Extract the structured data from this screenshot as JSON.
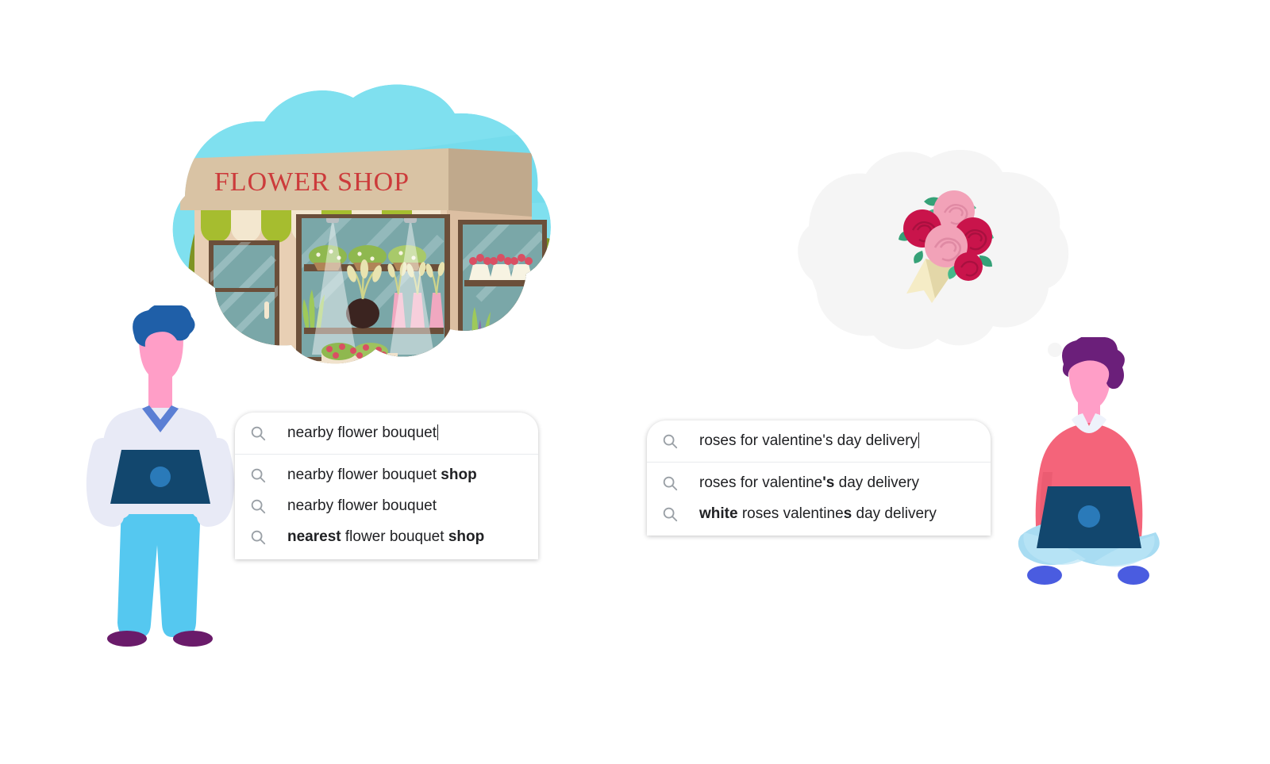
{
  "scene": {
    "background": "#ffffff",
    "left": {
      "name": "nearby-flower-shop-search",
      "thought_bubble": {
        "name": "flower-shop-thought-bubble",
        "fill": "#ffffff",
        "sky_color": "#7fe0ef",
        "sky_color_dark": "#63d6e8"
      },
      "shop": {
        "sign_text": "FLOWER SHOP",
        "sign_text_color": "#cc3b3b",
        "sign_fill": "#d9c3a4",
        "sign_fill_dark": "#c0a98c",
        "wall_color": "#e8cfb4",
        "awning_green": "#a6bd2f",
        "awning_cream": "#f3e7cf",
        "glass_color": "#7aa7a8",
        "bush_color": "#7e9424",
        "frame_color": "#6b4f3a"
      },
      "person": {
        "name": "standing-person-with-laptop",
        "hair": "#1f5fa8",
        "skin": "#ff9ec7",
        "shirt": "#e8eaf6",
        "laptop": "#12476e",
        "laptop_dot": "#2a7ab9",
        "pants": "#55c8f0",
        "shoes": "#6a1b6a",
        "collar": "#5b7fd4"
      },
      "search": {
        "name": "search-box-left",
        "icon": "search-icon",
        "query": "nearby flower bouquet",
        "placeholder": "Search",
        "caret_visible": true,
        "suggestions": [
          {
            "parts": [
              {
                "t": "nearby flower bouquet ",
                "b": false
              },
              {
                "t": "shop",
                "b": true
              }
            ]
          },
          {
            "parts": [
              {
                "t": "nearby flower bouquet",
                "b": false
              }
            ]
          },
          {
            "parts": [
              {
                "t": "nearest",
                "b": true
              },
              {
                "t": " flower bouquet ",
                "b": false
              },
              {
                "t": "shop",
                "b": true
              }
            ]
          }
        ]
      }
    },
    "right": {
      "name": "valentines-roses-search",
      "thought_bubble": {
        "name": "roses-thought-bubble",
        "fill": "#f5f5f5"
      },
      "bouquet": {
        "name": "rose-bouquet",
        "rose_dark": "#c9144b",
        "rose_dark_shade": "#a8103f",
        "rose_light": "#f2a2b8",
        "rose_light_shade": "#e08aa4",
        "leaf": "#45b98a",
        "leaf_dark": "#35a177",
        "wrap": "#f5ecc6",
        "wrap_shade": "#e3d7a8"
      },
      "person": {
        "name": "seated-person-with-laptop",
        "hair": "#6b1f7a",
        "skin": "#ff9ec7",
        "sweater": "#f4647a",
        "sweater_shade": "#e4566c",
        "collar": "#eef2fb",
        "laptop": "#12476e",
        "laptop_dot": "#2a7ab9",
        "legs": "#a8dcf2",
        "shoes": "#4a5ce0"
      },
      "search": {
        "name": "search-box-right",
        "icon": "search-icon",
        "query": "roses for valentine's day delivery",
        "placeholder": "Search",
        "caret_visible": true,
        "suggestions": [
          {
            "parts": [
              {
                "t": "roses for valentine",
                "b": false
              },
              {
                "t": "'s",
                "b": true
              },
              {
                "t": " day delivery",
                "b": false
              }
            ]
          },
          {
            "parts": [
              {
                "t": "white",
                "b": true
              },
              {
                "t": " roses valentine",
                "b": false
              },
              {
                "t": "s",
                "b": true
              },
              {
                "t": " day delivery",
                "b": false
              }
            ]
          }
        ]
      }
    }
  }
}
